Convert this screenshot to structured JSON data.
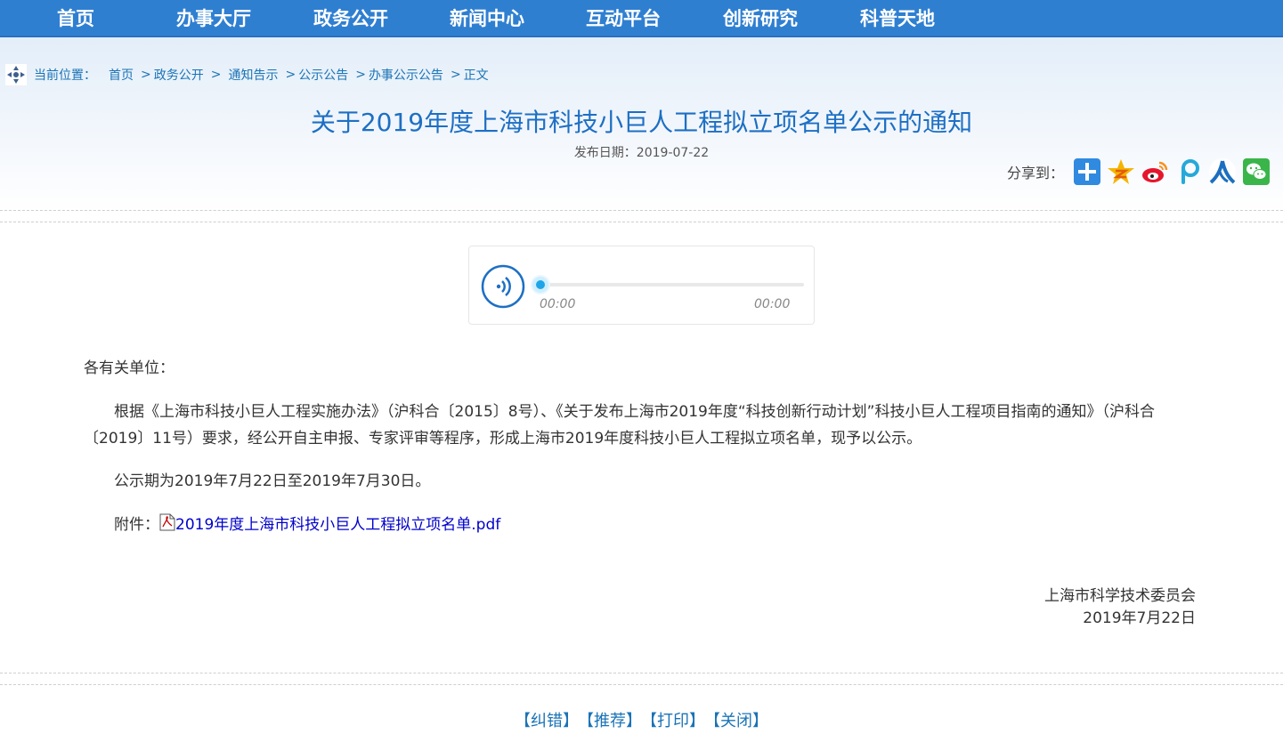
{
  "nav": {
    "items": [
      "首页",
      "办事大厅",
      "政务公开",
      "新闻中心",
      "互动平台",
      "创新研究",
      "科普天地"
    ]
  },
  "breadcrumb": {
    "label": "当前位置：",
    "items": [
      "首页",
      "政务公开",
      "通知告示",
      "公示公告",
      "办事公示公告",
      "正文"
    ],
    "separator": ">"
  },
  "article": {
    "title": "关于2019年度上海市科技小巨人工程拟立项名单公示的通知",
    "date_label": "发布日期：2019-07-22",
    "greeting": "各有关单位：",
    "para1": "根据《上海市科技小巨人工程实施办法》（沪科合〔2015〕8号）、《关于发布上海市2019年度“科技创新行动计划”科技小巨人工程项目指南的通知》（沪科合〔2019〕11号）要求，经公开自主申报、专家评审等程序，形成上海市2019年度科技小巨人工程拟立项名单，现予以公示。",
    "para2": "公示期为2019年7月22日至2019年7月30日。",
    "attachment_label": "附件：",
    "attachment_link": "2019年度上海市科技小巨人工程拟立项名单.pdf",
    "signature_org": "上海市科学技术委员会",
    "signature_date": "2019年7月22日"
  },
  "share": {
    "label": "分享到：",
    "icons": [
      "plus-share-icon",
      "qzone-icon",
      "weibo-icon",
      "pengyou-icon",
      "renren-icon",
      "wechat-icon"
    ]
  },
  "player": {
    "current_time": "00:00",
    "total_time": "00:00",
    "progress": 0
  },
  "footer": {
    "links": [
      "【纠错】",
      "【推荐】",
      "【打印】",
      "【关闭】"
    ]
  },
  "colors": {
    "nav_bg": "#2f7fd1",
    "title": "#1d6fc4",
    "link": "#1a73b6",
    "accent": "#1ea5e8"
  }
}
